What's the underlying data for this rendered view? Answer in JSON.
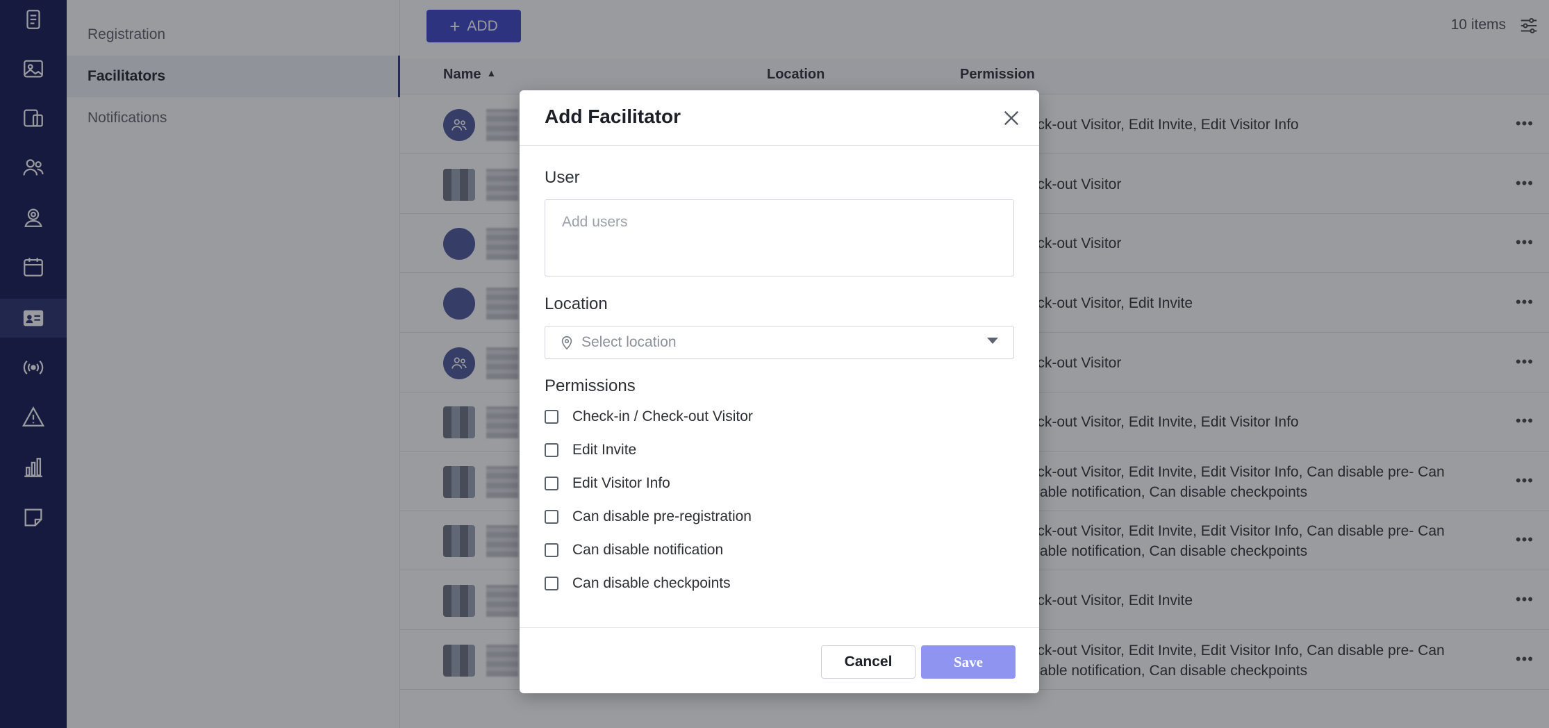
{
  "nav": {
    "icons": [
      "clipboard-icon",
      "image-icon",
      "devices-icon",
      "users-icon",
      "badge-icon",
      "calendar-icon",
      "id-card-icon",
      "broadcast-icon",
      "alert-icon",
      "chart-icon",
      "note-icon"
    ],
    "active_index": 6
  },
  "subnav": {
    "items": [
      {
        "label": "Registration"
      },
      {
        "label": "Facilitators"
      },
      {
        "label": "Notifications"
      }
    ],
    "active": "Facilitators"
  },
  "toolbar": {
    "add_label": "ADD",
    "items_count": "10 items"
  },
  "table": {
    "columns": {
      "name": "Name",
      "location": "Location",
      "permission": "Permission"
    },
    "rows": [
      {
        "permission": "heck-out Visitor, Edit Invite, Edit Visitor Info"
      },
      {
        "permission": "heck-out Visitor"
      },
      {
        "permission": "heck-out Visitor"
      },
      {
        "permission": "heck-out Visitor, Edit Invite"
      },
      {
        "permission": "heck-out Visitor"
      },
      {
        "permission": "heck-out Visitor, Edit Invite, Edit Visitor Info"
      },
      {
        "permission": "heck-out Visitor, Edit Invite, Edit Visitor Info, Can disable pre- Can disable notification, Can disable checkpoints"
      },
      {
        "permission": "heck-out Visitor, Edit Invite, Edit Visitor Info, Can disable pre- Can disable notification, Can disable checkpoints"
      },
      {
        "permission": "heck-out Visitor, Edit Invite"
      },
      {
        "permission": "heck-out Visitor, Edit Invite, Edit Visitor Info, Can disable pre- Can disable notification, Can disable checkpoints"
      }
    ]
  },
  "modal": {
    "title": "Add Facilitator",
    "user_label": "User",
    "user_placeholder": "Add users",
    "location_label": "Location",
    "location_placeholder": "Select location",
    "permissions_label": "Permissions",
    "permissions": [
      {
        "label": "Check-in / Check-out Visitor",
        "checked": false
      },
      {
        "label": "Edit Invite",
        "checked": false
      },
      {
        "label": "Edit Visitor Info",
        "checked": false
      },
      {
        "label": "Can disable pre-registration",
        "checked": false
      },
      {
        "label": "Can disable notification",
        "checked": false
      },
      {
        "label": "Can disable checkpoints",
        "checked": false
      }
    ],
    "cancel_label": "Cancel",
    "save_label": "Save"
  },
  "colors": {
    "rail_bg": "#0f1450",
    "primary": "#3a43c5",
    "save_disabled": "#8e94f0"
  }
}
